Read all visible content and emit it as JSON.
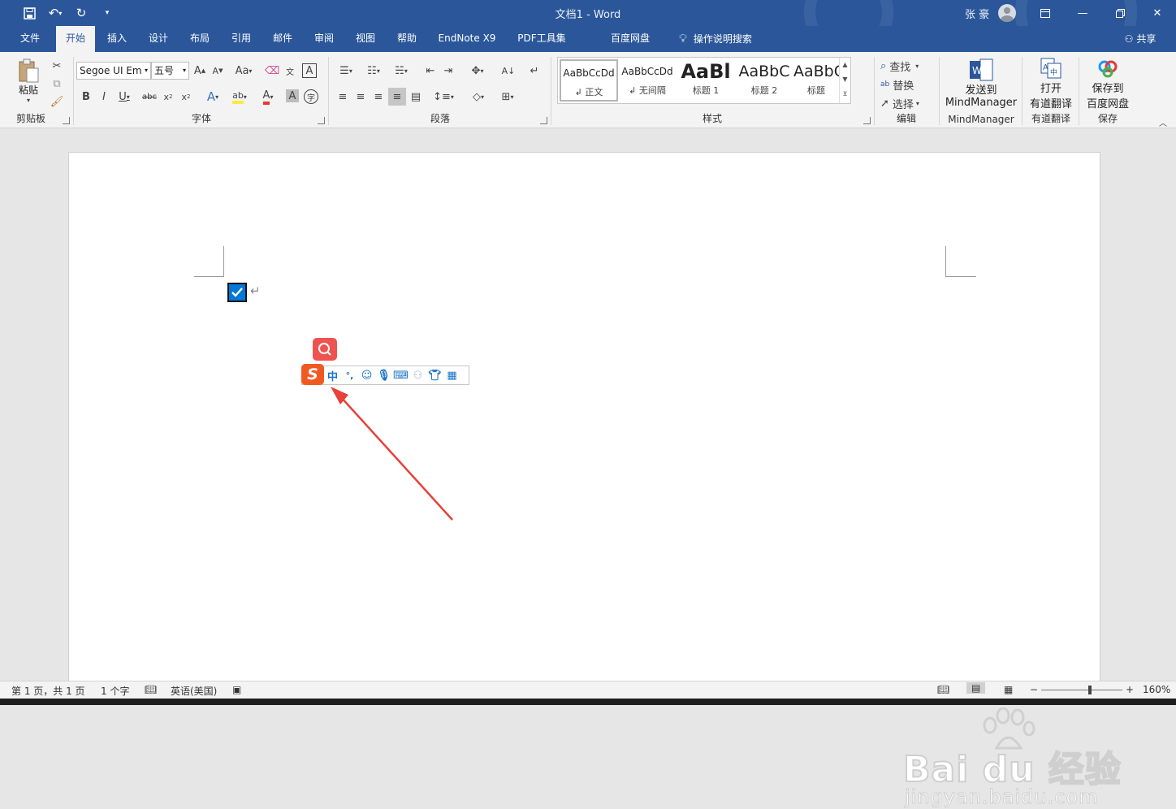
{
  "window": {
    "title": "文档1  -  Word",
    "user": "张 豪"
  },
  "tabs": [
    "文件",
    "开始",
    "插入",
    "设计",
    "布局",
    "引用",
    "邮件",
    "审阅",
    "视图",
    "帮助",
    "EndNote X9",
    "PDF工具集",
    "百度网盘"
  ],
  "tell_me": "操作说明搜索",
  "share": "共享",
  "clipboard": {
    "paste": "粘贴",
    "label": "剪贴板"
  },
  "font": {
    "name": "Segoe UI Em",
    "size": "五号",
    "label": "字体",
    "case_btn": "Aa"
  },
  "paragraph": {
    "label": "段落"
  },
  "styles": {
    "label": "样式",
    "items": [
      {
        "preview": "AaBbCcDd",
        "name": "正文"
      },
      {
        "preview": "AaBbCcDd",
        "name": "无间隔"
      },
      {
        "preview": "AaBl",
        "name": "标题 1"
      },
      {
        "preview": "AaBbC",
        "name": "标题 2"
      },
      {
        "preview": "AaBbC",
        "name": "标题"
      }
    ]
  },
  "editing": {
    "find": "查找",
    "replace": "替换",
    "select": "选择",
    "label": "编辑"
  },
  "mindmanager": {
    "line1": "发送到",
    "line2": "MindManager",
    "label": "MindManager"
  },
  "youdao": {
    "line1": "打开",
    "line2": "有道翻译",
    "label": "有道翻译"
  },
  "baidu": {
    "line1": "保存到",
    "line2": "百度网盘",
    "label": "保存"
  },
  "ime": {
    "logo": "S",
    "mode": "中",
    "punct": "°,"
  },
  "status": {
    "page": "第 1 页，共 1 页",
    "words": "1 个字",
    "language": "英语(美国)",
    "zoom": "160%",
    "zoom_level": 0.6
  },
  "watermark": {
    "brand": "Bai du 经验",
    "url": "jingyan.baidu.com"
  },
  "colors": {
    "accent": "#2b579a",
    "checkbox": "#0078d7",
    "arrow": "#e8403a",
    "ime": "#f05a22"
  }
}
